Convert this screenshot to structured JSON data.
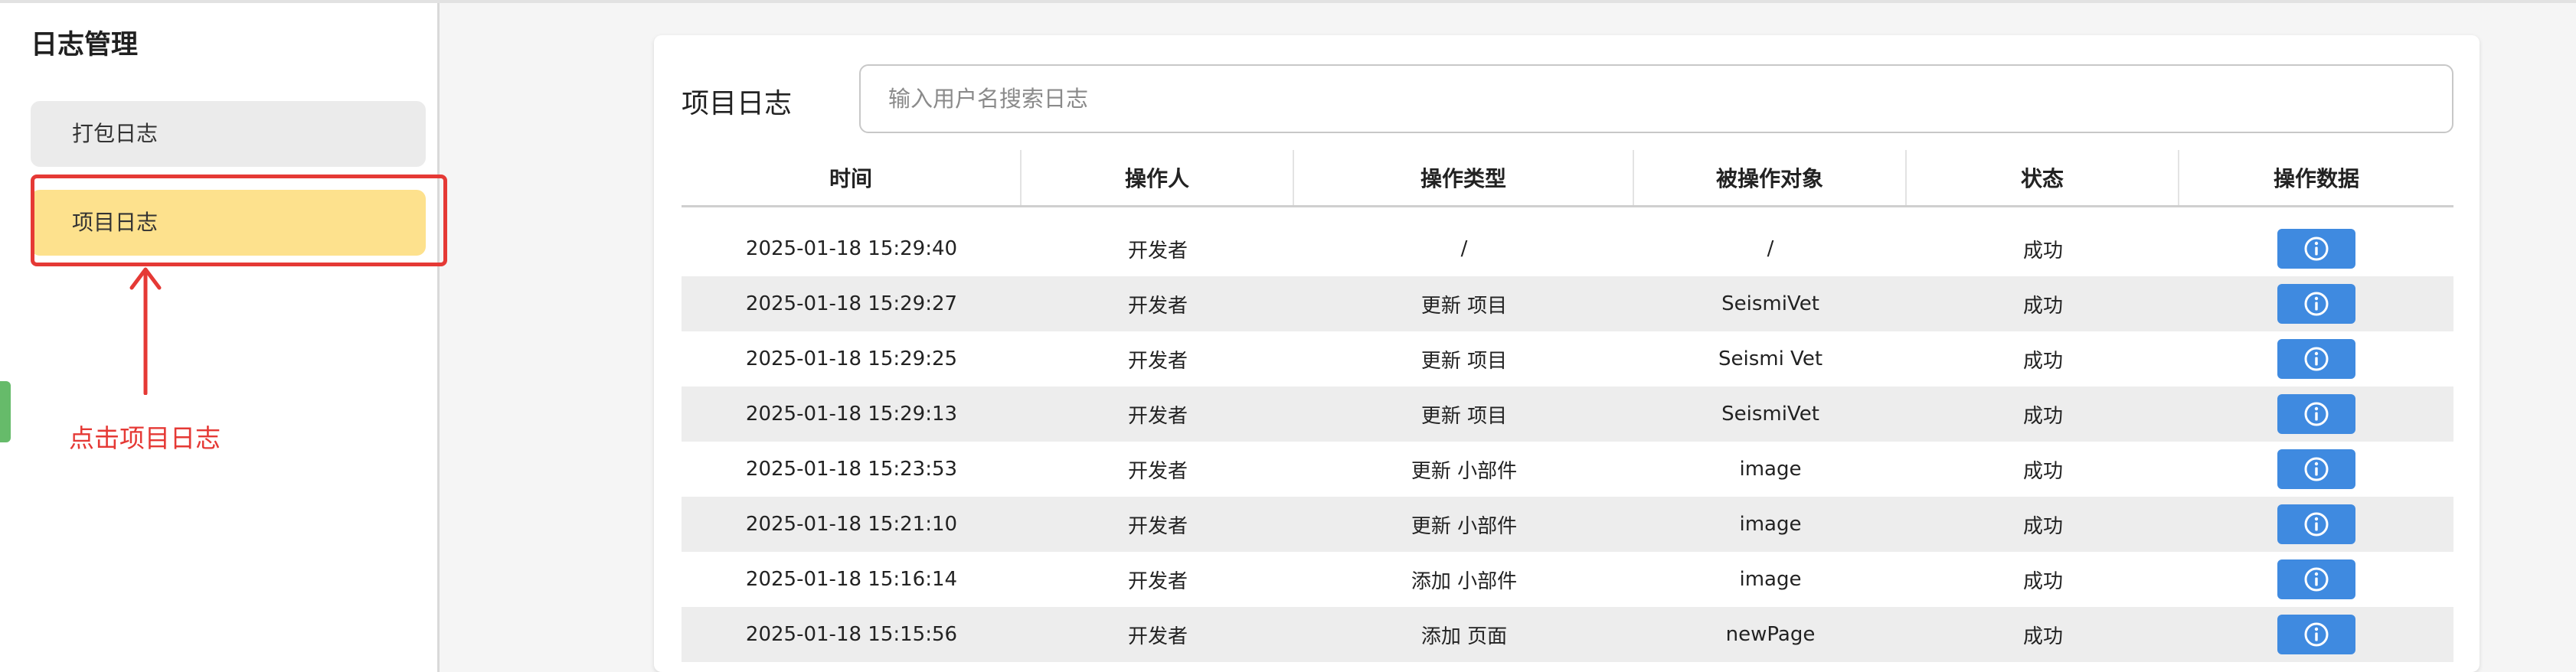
{
  "sidebar": {
    "title": "日志管理",
    "items": [
      {
        "label": "打包日志"
      },
      {
        "label": "项目日志"
      }
    ]
  },
  "annotation": {
    "text": "点击项目日志",
    "color": "#e53935"
  },
  "main": {
    "title": "项目日志",
    "search": {
      "placeholder": "输入用户名搜索日志",
      "value": ""
    },
    "columns": [
      "时间",
      "操作人",
      "操作类型",
      "被操作对象",
      "状态",
      "操作数据"
    ],
    "rows": [
      {
        "time": "2025-01-18 15:29:40",
        "operator": "开发者",
        "type": "/",
        "target": "/",
        "status": "成功",
        "action_icon": "info-icon"
      },
      {
        "time": "2025-01-18 15:29:27",
        "operator": "开发者",
        "type": "更新 项目",
        "target": "SeismiVet",
        "status": "成功",
        "action_icon": "info-icon"
      },
      {
        "time": "2025-01-18 15:29:25",
        "operator": "开发者",
        "type": "更新 项目",
        "target": "Seismi Vet",
        "status": "成功",
        "action_icon": "info-icon"
      },
      {
        "time": "2025-01-18 15:29:13",
        "operator": "开发者",
        "type": "更新 项目",
        "target": "SeismiVet",
        "status": "成功",
        "action_icon": "info-icon"
      },
      {
        "time": "2025-01-18 15:23:53",
        "operator": "开发者",
        "type": "更新 小部件",
        "target": "image",
        "status": "成功",
        "action_icon": "info-icon"
      },
      {
        "time": "2025-01-18 15:21:10",
        "operator": "开发者",
        "type": "更新 小部件",
        "target": "image",
        "status": "成功",
        "action_icon": "info-icon"
      },
      {
        "time": "2025-01-18 15:16:14",
        "operator": "开发者",
        "type": "添加 小部件",
        "target": "image",
        "status": "成功",
        "action_icon": "info-icon"
      },
      {
        "time": "2025-01-18 15:15:56",
        "operator": "开发者",
        "type": "添加 页面",
        "target": "newPage",
        "status": "成功",
        "action_icon": "info-icon"
      }
    ]
  },
  "colors": {
    "active_nav": "#fde18d",
    "info_button": "#3f8ae0",
    "annotation_red": "#e53935"
  }
}
